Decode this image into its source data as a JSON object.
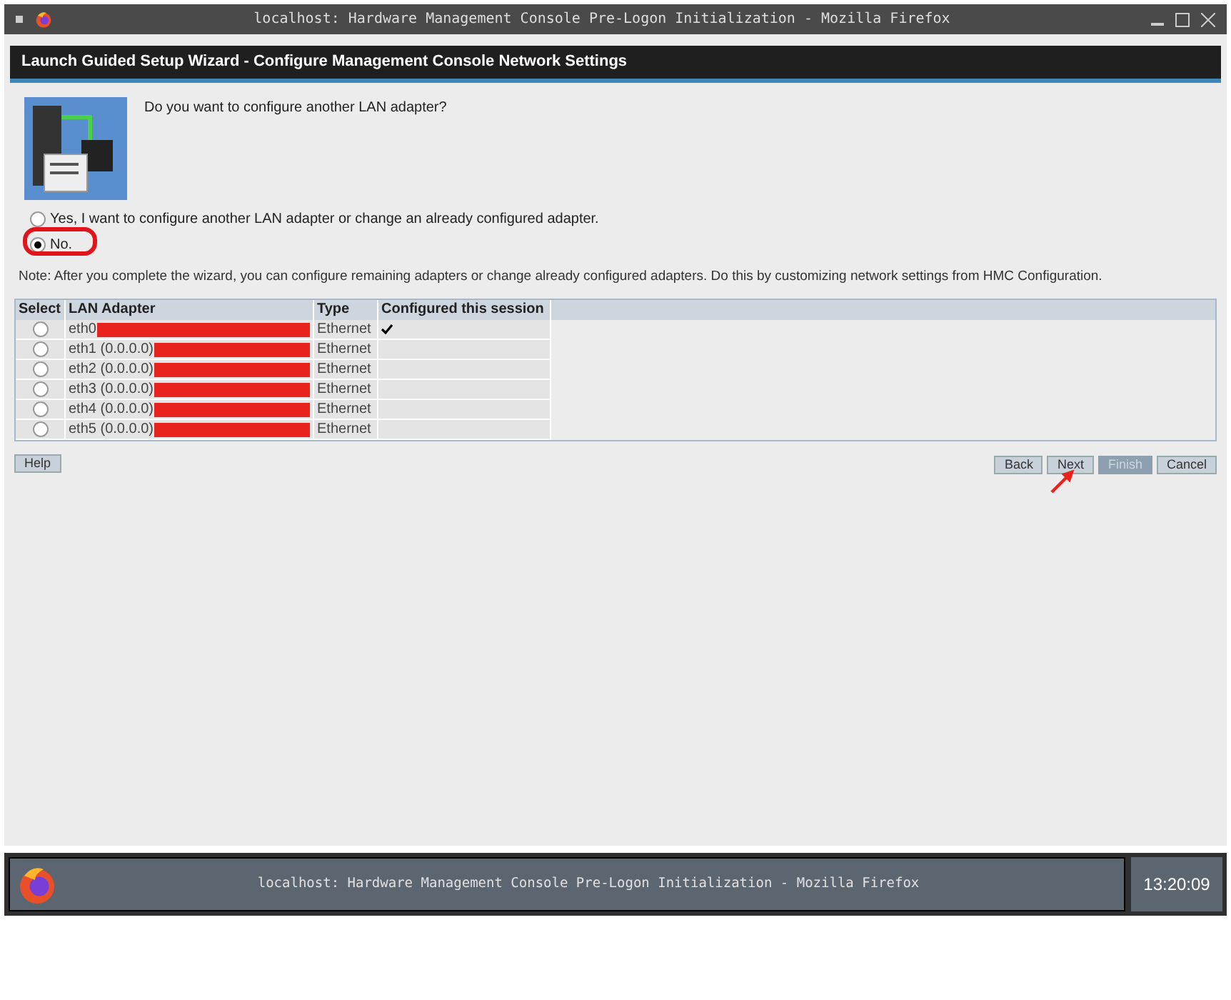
{
  "window": {
    "title": "localhost: Hardware Management Console Pre-Logon Initialization - Mozilla Firefox"
  },
  "dialog": {
    "title": "Launch Guided Setup Wizard - Configure Management Console Network Settings"
  },
  "question": "Do you want to configure another LAN adapter?",
  "options": [
    {
      "label": "Yes, I want to configure another LAN adapter or change an already configured adapter.",
      "selected": false
    },
    {
      "label": "No.",
      "selected": true,
      "highlighted": true
    }
  ],
  "note": "Note: After you complete the wizard, you can configure remaining adapters or change already configured adapters. Do this by customizing network settings from HMC Configuration.",
  "table": {
    "columns": [
      "Select",
      "LAN Adapter",
      "Type",
      "Configured this session"
    ],
    "rows": [
      {
        "selected": false,
        "adapter": "eth0",
        "type": "Ethernet",
        "configured": true
      },
      {
        "selected": false,
        "adapter": "eth1 (0.0.0.0)",
        "type": "Ethernet",
        "configured": false
      },
      {
        "selected": false,
        "adapter": "eth2 (0.0.0.0)",
        "type": "Ethernet",
        "configured": false
      },
      {
        "selected": false,
        "adapter": "eth3 (0.0.0.0)",
        "type": "Ethernet",
        "configured": false
      },
      {
        "selected": false,
        "adapter": "eth4 (0.0.0.0)",
        "type": "Ethernet",
        "configured": false
      },
      {
        "selected": false,
        "adapter": "eth5 (0.0.0.0)",
        "type": "Ethernet",
        "configured": false
      }
    ]
  },
  "help_button": "Help",
  "buttons": [
    {
      "label": "Back",
      "disabled": false,
      "pointed": false
    },
    {
      "label": "Next",
      "disabled": false,
      "pointed": true
    },
    {
      "label": "Finish",
      "disabled": true,
      "pointed": false
    },
    {
      "label": "Cancel",
      "disabled": false,
      "pointed": false
    }
  ],
  "taskbar": {
    "task": "localhost: Hardware Management Console Pre-Logon Initialization - Mozilla Firefox",
    "clock": "13:20:09"
  }
}
